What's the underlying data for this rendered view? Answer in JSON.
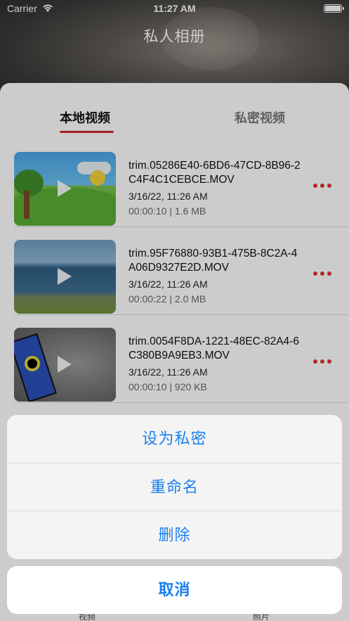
{
  "status_bar": {
    "carrier": "Carrier",
    "time": "11:27 AM"
  },
  "nav": {
    "title": "私人相册"
  },
  "tabs": [
    {
      "label": "本地视频",
      "selected": true
    },
    {
      "label": "私密视频",
      "selected": false
    }
  ],
  "videos": [
    {
      "filename": "trim.05286E40-6BD6-47CD-8B96-2C4F4C1CEBCE.MOV",
      "date": "3/16/22, 11:26 AM",
      "meta": "00:00:10 | 1.6 MB"
    },
    {
      "filename": "trim.95F76880-93B1-475B-8C2A-4A06D9327E2D.MOV",
      "date": "3/16/22, 11:26 AM",
      "meta": "00:00:22 | 2.0 MB"
    },
    {
      "filename": "trim.0054F8DA-1221-48EC-82A4-6C380B9A9EB3.MOV",
      "date": "3/16/22, 11:26 AM",
      "meta": "00:00:10 | 920 KB"
    }
  ],
  "action_sheet": {
    "items": [
      "设为私密",
      "重命名",
      "删除"
    ],
    "cancel": "取消"
  },
  "tabbar": {
    "left": "视频",
    "right": "照片"
  },
  "colors": {
    "accent": "#1a7ff0",
    "tab_underline": "#d02a2a",
    "more_dots": "#dd3333"
  }
}
